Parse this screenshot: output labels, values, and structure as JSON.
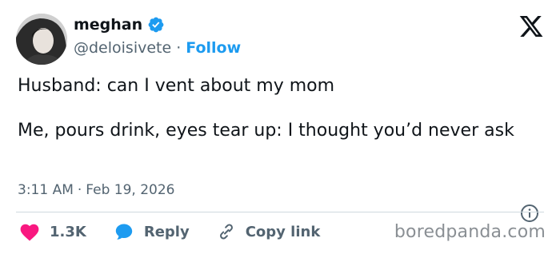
{
  "author": {
    "display_name": "meghan",
    "handle": "@deloisivete",
    "separator": "·",
    "follow_label": "Follow"
  },
  "tweet": {
    "text": "Husband: can I vent about my mom\n\nMe, pours drink, eyes tear up: I thought you’d never ask",
    "time": "3:11 AM",
    "date_separator": "·",
    "date": "Feb 19, 2026"
  },
  "actions": {
    "like_count": "1.3K",
    "reply_label": "Reply",
    "copy_link_label": "Copy link"
  },
  "watermark": "boredpanda.com",
  "colors": {
    "accent": "#1d9bf0",
    "like": "#f91880",
    "text": "#0f1419",
    "muted": "#536471"
  },
  "icons": {
    "verified": "verified-badge-icon",
    "platform": "x-logo-icon",
    "info": "info-icon",
    "like": "heart-icon",
    "reply": "speech-bubble-icon",
    "copy_link": "link-icon"
  }
}
